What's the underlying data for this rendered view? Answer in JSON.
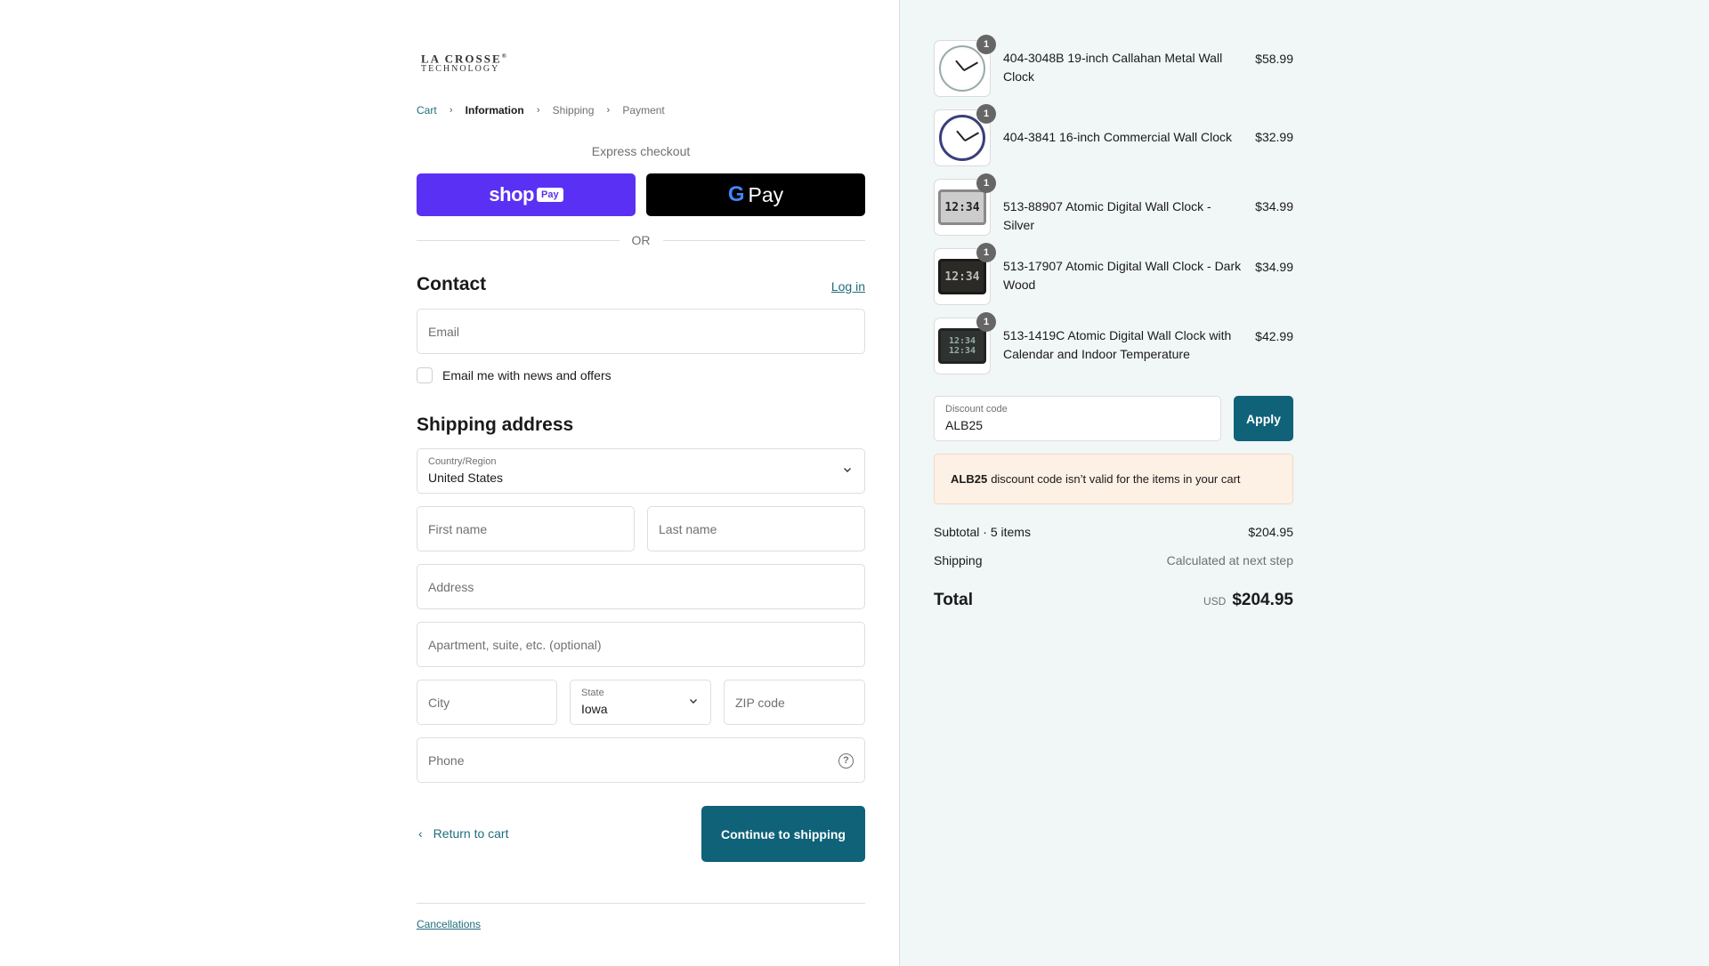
{
  "logo": {
    "line1": "LA CROSSE",
    "line2": "TECHNOLOGY",
    "mark": "®"
  },
  "breadcrumb": {
    "items": [
      {
        "label": "Cart"
      },
      {
        "label": "Information"
      },
      {
        "label": "Shipping"
      },
      {
        "label": "Payment"
      }
    ],
    "separator_icon": "chevron-right-icon"
  },
  "express": {
    "heading": "Express checkout",
    "shop_pay": {
      "word": "shop",
      "pill": "Pay"
    },
    "google_pay": {
      "g": "G",
      "word": "Pay"
    },
    "or_label": "OR"
  },
  "contact": {
    "heading": "Contact",
    "login_label": "Log in",
    "email_placeholder": "Email",
    "newsletter_label": "Email me with news and offers",
    "newsletter_checked": false
  },
  "shipping": {
    "heading": "Shipping address",
    "country_label": "Country/Region",
    "country_value": "United States",
    "first_name_placeholder": "First name",
    "last_name_placeholder": "Last name",
    "address_placeholder": "Address",
    "apartment_placeholder": "Apartment, suite, etc. (optional)",
    "city_placeholder": "City",
    "state_label": "State",
    "state_value": "Iowa",
    "zip_placeholder": "ZIP code",
    "phone_placeholder": "Phone",
    "help_icon": "question-circle-icon"
  },
  "actions": {
    "return_label": "Return to cart",
    "continue_label": "Continue to shipping"
  },
  "footer": {
    "cancellations_label": "Cancellations"
  },
  "cart": {
    "items": [
      {
        "name": "404-3048B 19-inch Callahan Metal Wall Clock",
        "price": "$58.99",
        "qty": "1",
        "thumb": "analog-clock-silver"
      },
      {
        "name": "404-3841 16-inch Commercial Wall Clock",
        "price": "$32.99",
        "qty": "1",
        "thumb": "analog-clock-blue"
      },
      {
        "name": "513-88907 Atomic Digital Wall Clock - Silver",
        "price": "$34.99",
        "qty": "1",
        "thumb": "digital-clock-silver",
        "display": "12:34"
      },
      {
        "name": "513-17907 Atomic Digital Wall Clock - Dark Wood",
        "price": "$34.99",
        "qty": "1",
        "thumb": "digital-clock-dark",
        "display": "12:34"
      },
      {
        "name": "513-1419C Atomic Digital Wall Clock with Calendar and Indoor Temperature",
        "price": "$42.99",
        "qty": "1",
        "thumb": "digital-clock-calendar",
        "display_top": "12:34",
        "display_bottom": "12:34"
      }
    ],
    "discount": {
      "label": "Discount code",
      "value": "ALB25",
      "apply_label": "Apply"
    },
    "error": {
      "code": "ALB25",
      "message": "discount code isn’t valid for the items in your cart"
    },
    "subtotal_label": "Subtotal · 5 items",
    "subtotal_value": "$204.95",
    "shipping_label": "Shipping",
    "shipping_value": "Calculated at next step",
    "total_label": "Total",
    "currency": "USD",
    "total_value": "$204.95"
  },
  "colors": {
    "accent": "#0f6278",
    "link": "#1f6d7a",
    "shop_pay": "#5a31f4",
    "sidebar_bg": "#f1f6f6",
    "error_bg": "#fdf0e5"
  }
}
